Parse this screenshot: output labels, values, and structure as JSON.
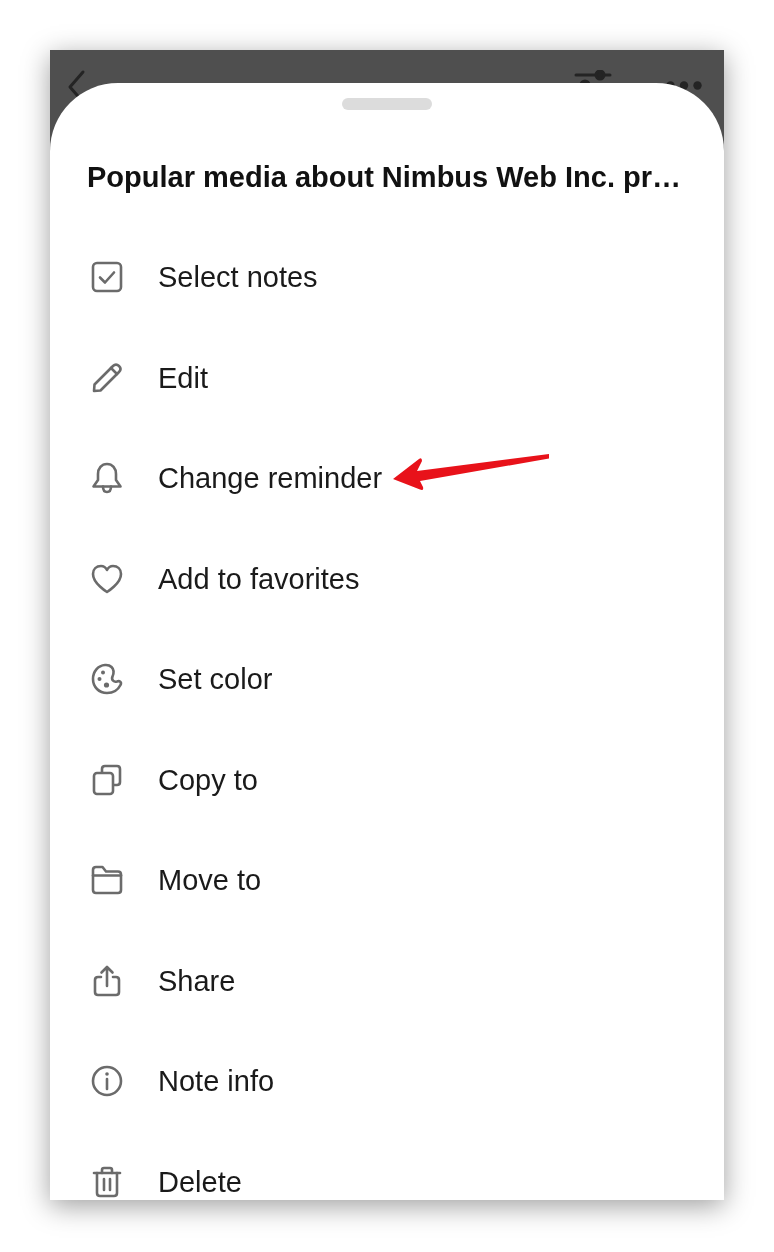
{
  "sheet": {
    "title": "Popular media about Nimbus Web Inc. pr…",
    "items": [
      {
        "label": "Select notes",
        "kind": "checkbox",
        "pointed": false
      },
      {
        "label": "Edit",
        "kind": "pencil",
        "pointed": false
      },
      {
        "label": "Change reminder",
        "kind": "bell",
        "pointed": true
      },
      {
        "label": "Add to favorites",
        "kind": "heart",
        "pointed": false
      },
      {
        "label": "Set color",
        "kind": "palette",
        "pointed": false
      },
      {
        "label": "Copy to",
        "kind": "copy",
        "pointed": false
      },
      {
        "label": "Move to",
        "kind": "folder",
        "pointed": false
      },
      {
        "label": "Share",
        "kind": "share",
        "pointed": false
      },
      {
        "label": "Note info",
        "kind": "info",
        "pointed": false
      },
      {
        "label": "Delete",
        "kind": "trash",
        "pointed": false
      }
    ]
  }
}
